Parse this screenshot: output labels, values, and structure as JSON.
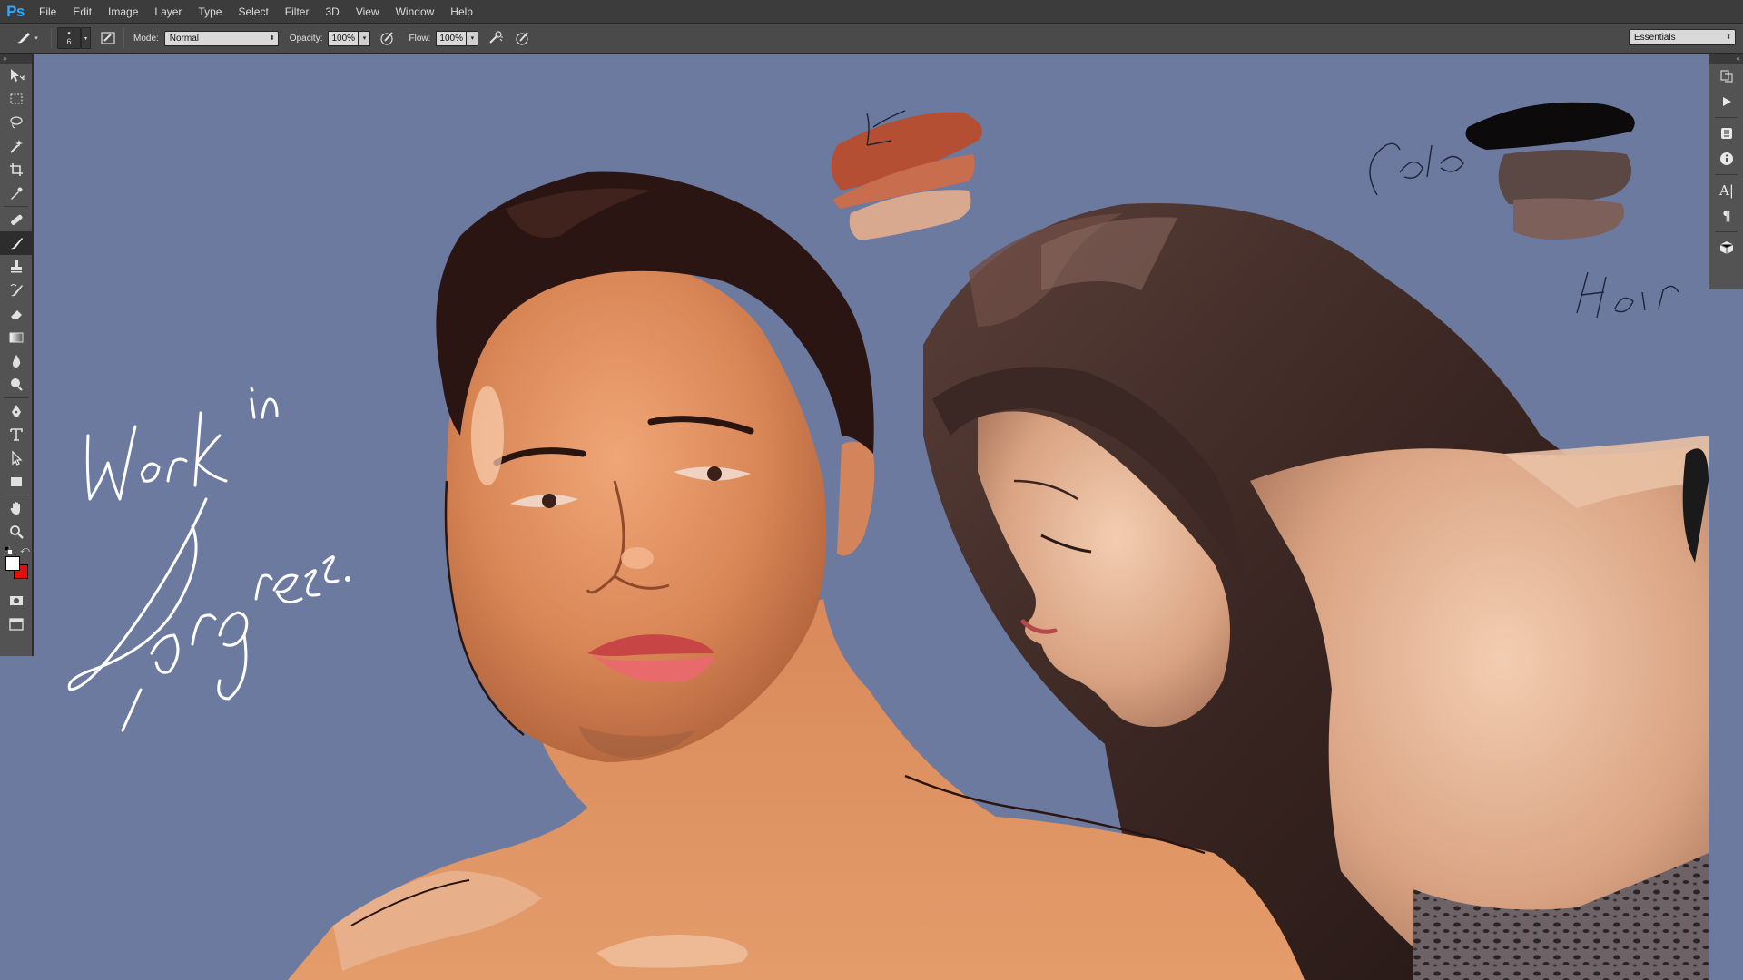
{
  "app": {
    "logo": "Ps"
  },
  "menu": [
    "File",
    "Edit",
    "Image",
    "Layer",
    "Type",
    "Select",
    "Filter",
    "3D",
    "View",
    "Window",
    "Help"
  ],
  "options": {
    "brush_size": "6",
    "mode_label": "Mode:",
    "mode_value": "Normal",
    "opacity_label": "Opacity:",
    "opacity_value": "100%",
    "flow_label": "Flow:",
    "flow_value": "100%",
    "workspace": "Essentials"
  },
  "tools": [
    "move-tool",
    "marquee-tool",
    "lasso-tool",
    "magic-wand-tool",
    "crop-tool",
    "eyedropper-tool",
    "healing-brush-tool",
    "brush-tool",
    "clone-stamp-tool",
    "history-brush-tool",
    "eraser-tool",
    "gradient-tool",
    "blur-tool",
    "dodge-tool",
    "pen-tool",
    "type-tool",
    "path-selection-tool",
    "rectangle-tool",
    "hand-tool",
    "zoom-tool"
  ],
  "colors": {
    "foreground": "#ffffff",
    "background": "#e10f0f",
    "canvas_bg": "#6d7aa0",
    "accent": "#31a8ff"
  },
  "dock": [
    "history-icon",
    "actions-play-icon",
    "adjustments-icon",
    "info-icon",
    "character-icon",
    "paragraph-icon",
    "3d-cube-icon"
  ],
  "canvas_text": {
    "work": "Work in",
    "progress": "Progress.",
    "color_note": "Colo",
    "hair_note": "Hair"
  }
}
